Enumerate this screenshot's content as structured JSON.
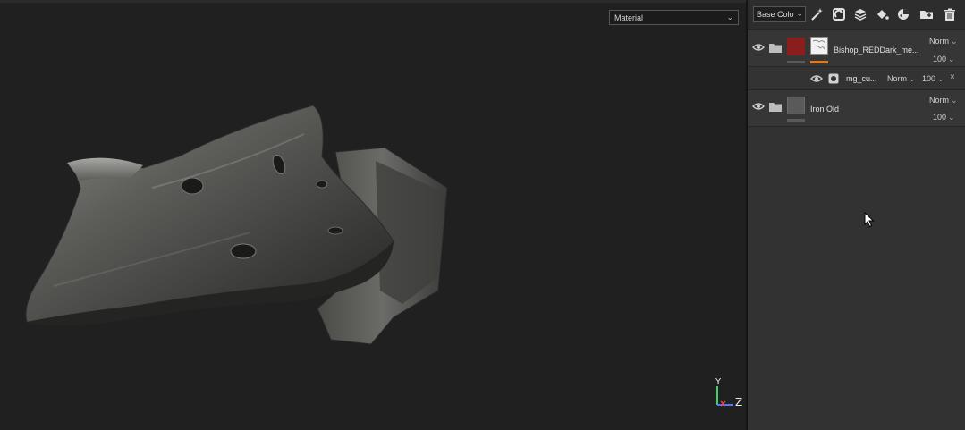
{
  "viewport": {
    "mode_select": {
      "value": "Material"
    },
    "axis": {
      "y_label": "Y",
      "z_label": "Z"
    }
  },
  "layers_panel": {
    "channel_select": {
      "value": "Base Colo"
    },
    "toolbar_icons": [
      "magic-wand-icon",
      "mask-icon",
      "add-layer-icon",
      "fill-icon",
      "generator-icon",
      "add-folder-icon",
      "trash-icon"
    ],
    "layers": [
      {
        "name": "Bishop_REDDark_me...",
        "blend_mode": "Norm",
        "opacity": "100",
        "color_swatch": "#8a1d1d",
        "effect": {
          "name": "mg_cu...",
          "blend_mode": "Norm",
          "opacity": "100",
          "close": "×"
        }
      },
      {
        "name": "Iron Old",
        "blend_mode": "Norm",
        "opacity": "100",
        "color_swatch": "#5a5a5a"
      }
    ]
  },
  "colors": {
    "accent_orange": "#e07a1f",
    "layer_red": "#8a1d1d"
  }
}
